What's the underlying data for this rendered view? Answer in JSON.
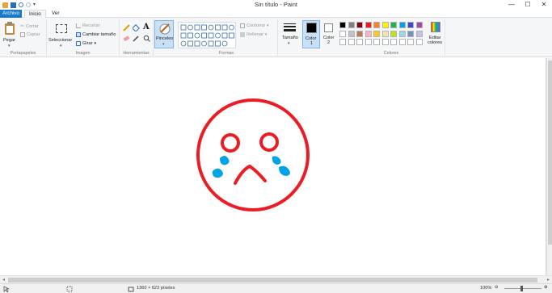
{
  "window": {
    "title": "Sin título - Paint",
    "minimize": "—",
    "maximize": "☐",
    "close": "✕"
  },
  "tabs": {
    "file": "Archivo",
    "home": "Inicio",
    "view": "Ver"
  },
  "clipboard": {
    "paste": "Pegar",
    "cut": "Cortar",
    "copy": "Copiar",
    "label": "Portapapeles"
  },
  "image": {
    "select": "Seleccionar",
    "crop": "Recortar",
    "resize": "Cambiar tamaño",
    "rotate": "Girar",
    "label": "Imagen"
  },
  "tools": {
    "label": "Herramientas",
    "text_glyph": "A"
  },
  "brushes": {
    "label": "Pinceles"
  },
  "shapes": {
    "outline": "Contorno",
    "fill": "Rellenar",
    "label": "Formas"
  },
  "size": {
    "label": "Tamaño"
  },
  "color1": {
    "label": "Color",
    "num": "1",
    "value": "#000000"
  },
  "color2": {
    "label": "Color",
    "num": "2",
    "value": "#ffffff"
  },
  "colors": {
    "label": "Colores",
    "edit_label_1": "Editar",
    "edit_label_2": "colores",
    "row1": [
      "#000000",
      "#7f7f7f",
      "#880015",
      "#ed1c24",
      "#ff7f27",
      "#fff200",
      "#22b14c",
      "#00a2e8",
      "#3f48cc",
      "#a349a4"
    ],
    "row2": [
      "#ffffff",
      "#c3c3c3",
      "#b97a57",
      "#ffaec9",
      "#ffc90e",
      "#efe4b0",
      "#b5e61d",
      "#99d9ea",
      "#7092be",
      "#c8bfe7"
    ],
    "row3": [
      "#ffffff",
      "#ffffff",
      "#ffffff",
      "#ffffff",
      "#ffffff",
      "#ffffff",
      "#ffffff",
      "#ffffff",
      "#ffffff",
      "#ffffff"
    ]
  },
  "drawing": {
    "face_color": "#ed1c24",
    "tear_color": "#00a2e8"
  },
  "status": {
    "image_size": "1360 × 623 píxeles",
    "zoom": "100%"
  }
}
